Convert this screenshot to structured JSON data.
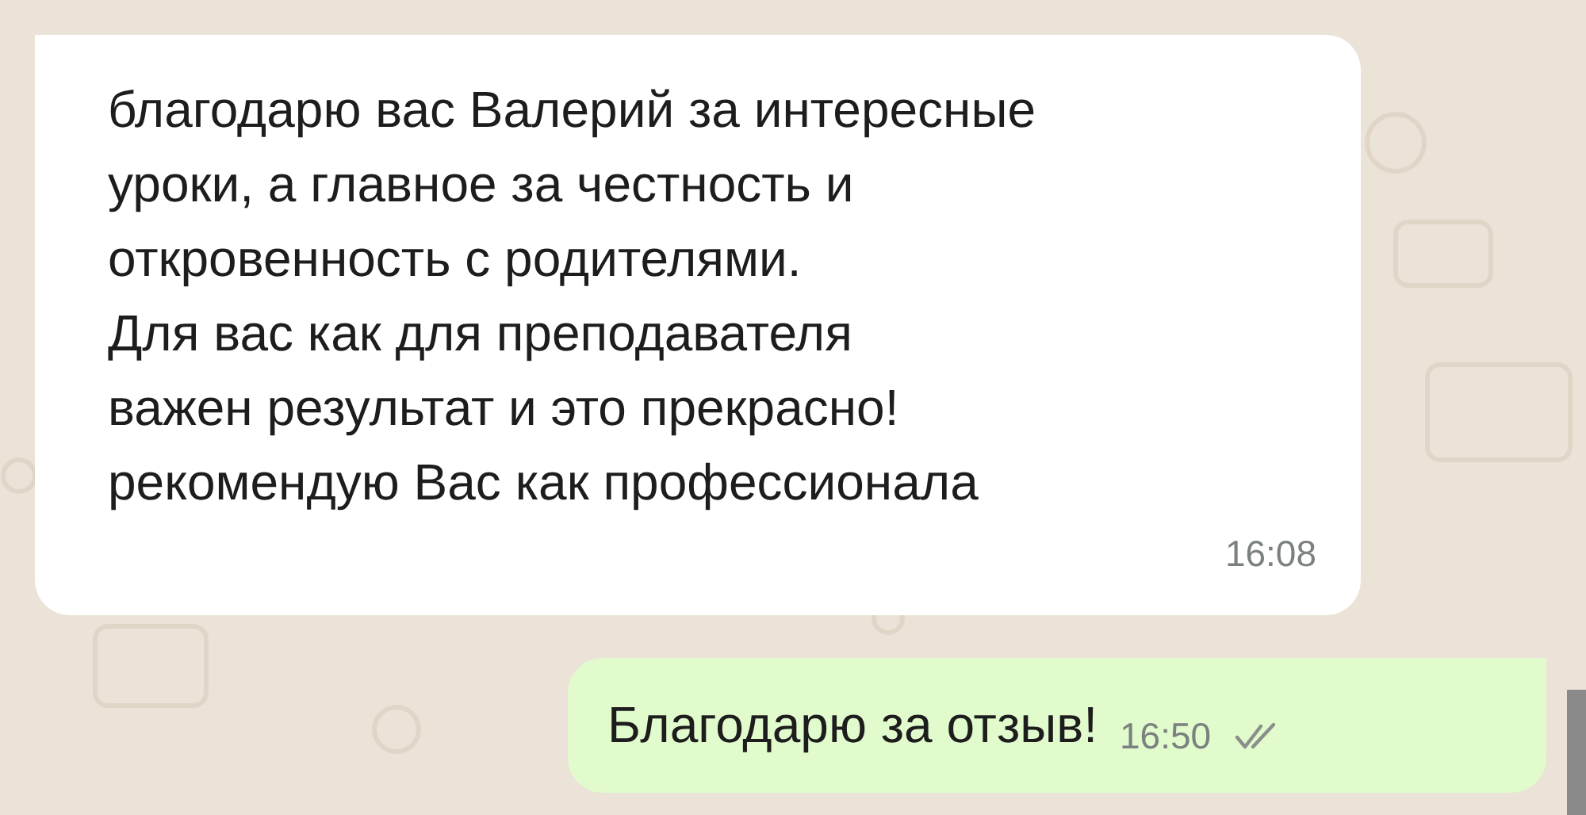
{
  "messages": [
    {
      "kind": "incoming",
      "lines": [
        "благодарю вас Валерий за интересные",
        "уроки, а главное за честность и",
        "откровенность с родителями.",
        "Для вас как для преподавателя",
        "важен результат и это прекрасно!",
        "рекомендую Вас как профессионала"
      ],
      "time": "16:08"
    },
    {
      "kind": "outgoing",
      "lines": [
        "Благодарю за отзыв!"
      ],
      "time": "16:50",
      "read": false
    }
  ]
}
